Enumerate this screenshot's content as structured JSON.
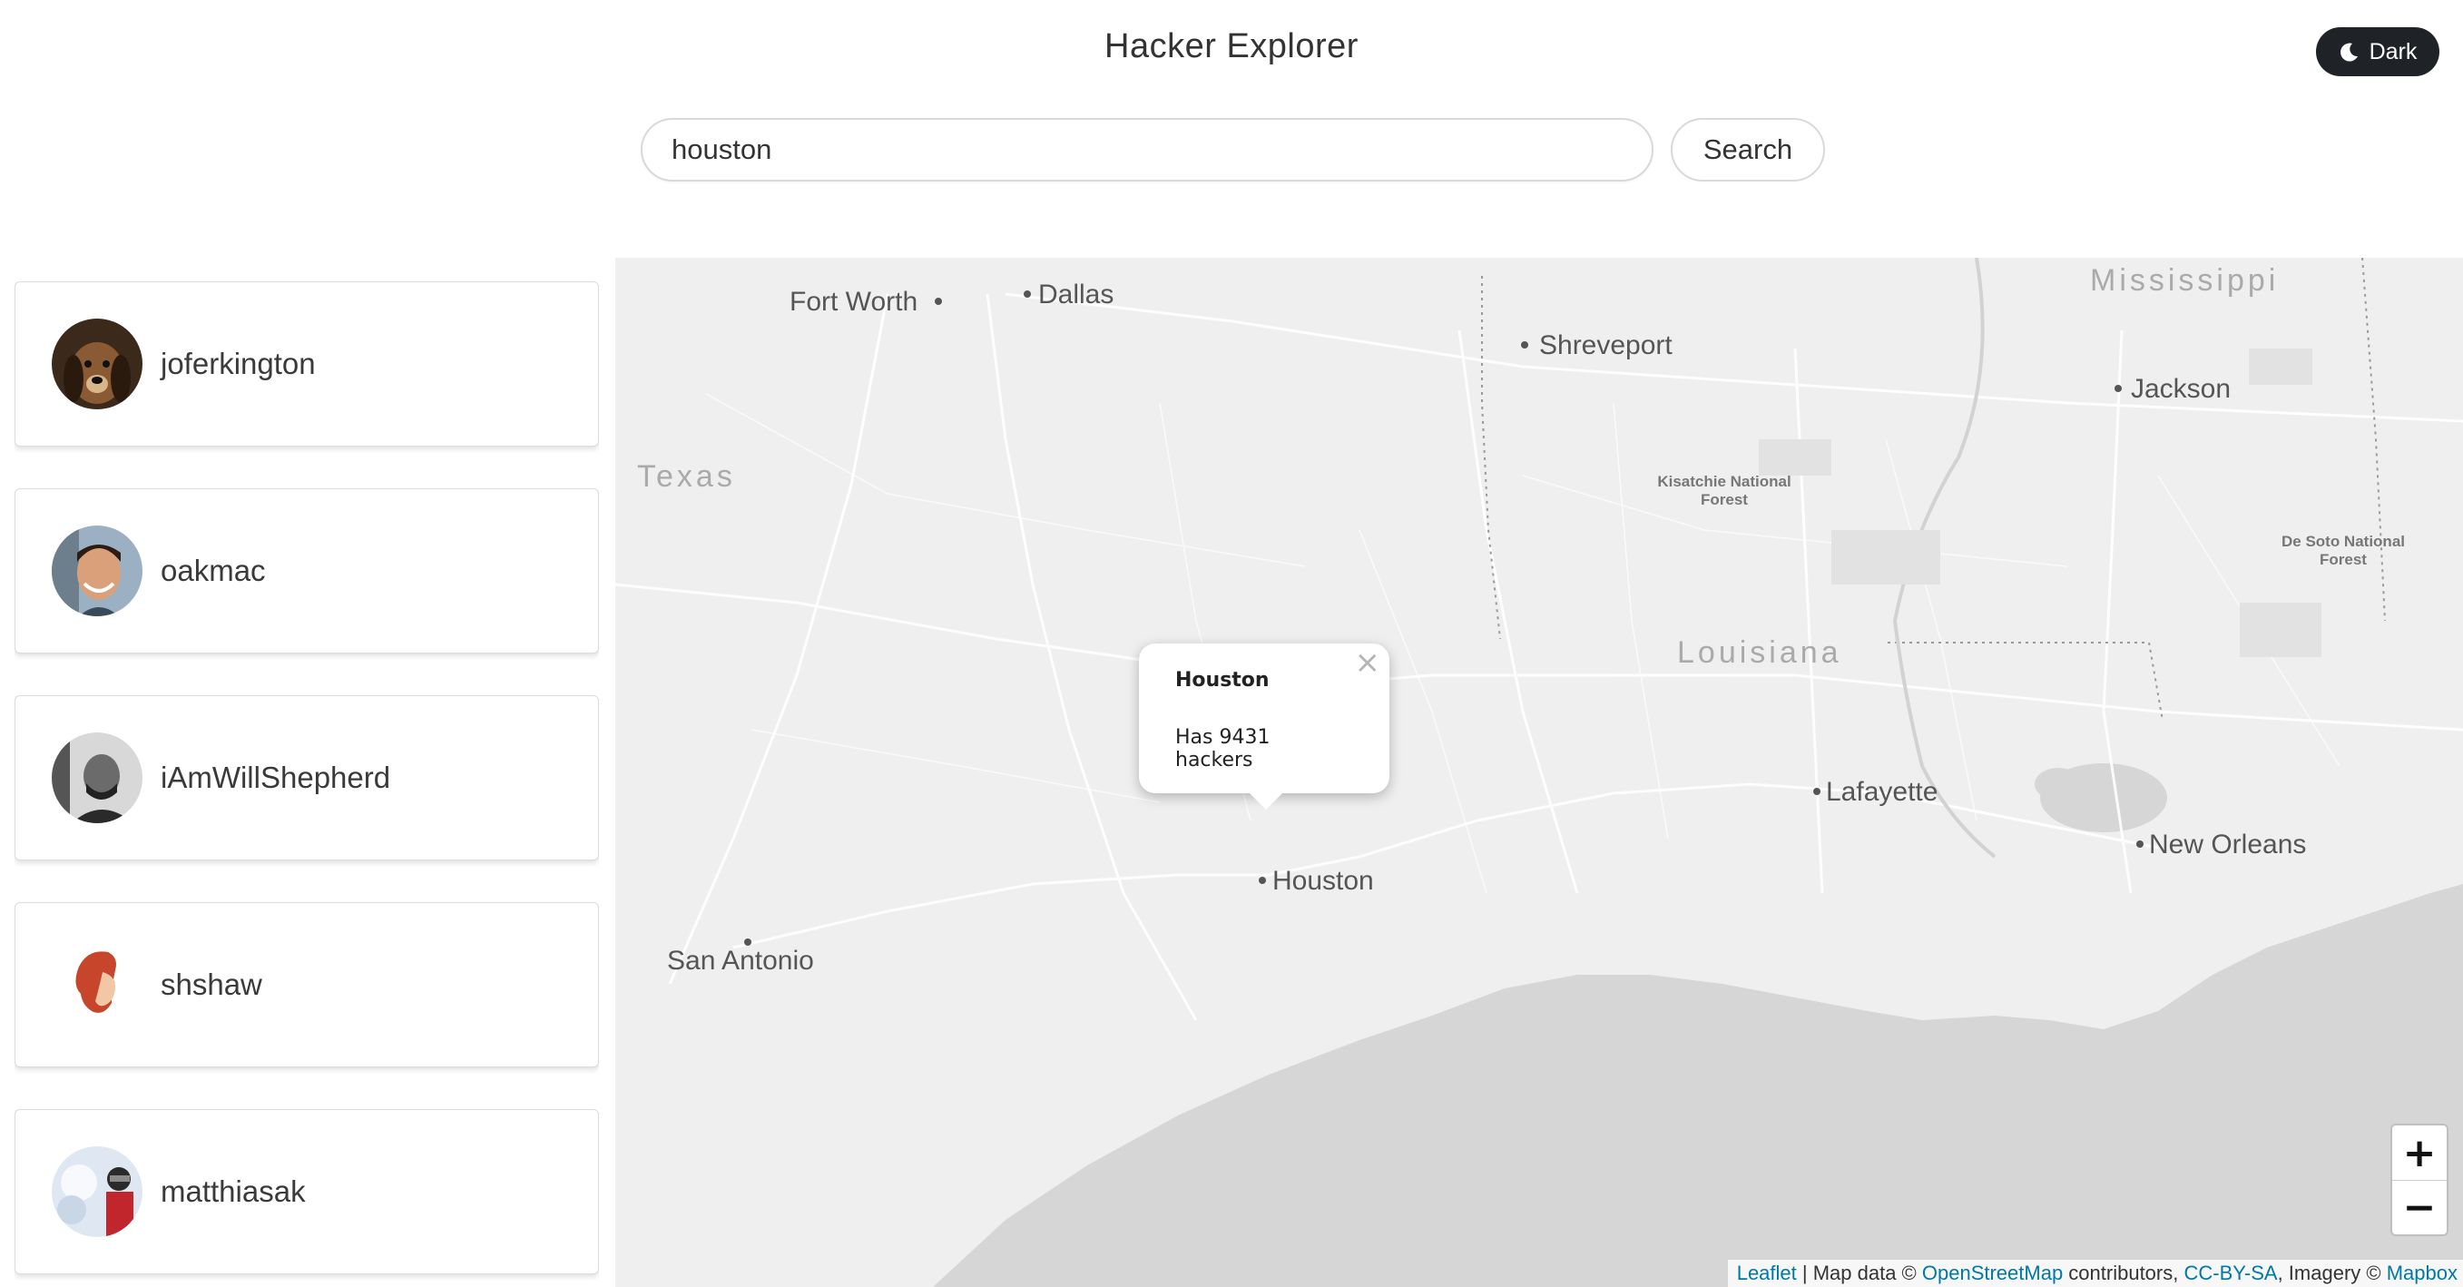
{
  "header": {
    "title": "Hacker Explorer",
    "theme_toggle_label": "Dark",
    "theme_toggle_icon": "moon-icon"
  },
  "search": {
    "value": "houston",
    "placeholder": "",
    "button_label": "Search"
  },
  "users": [
    {
      "name": "joferkington"
    },
    {
      "name": "oakmac"
    },
    {
      "name": "iAmWillShepherd"
    },
    {
      "name": "shshaw"
    },
    {
      "name": "matthiasak"
    }
  ],
  "map": {
    "labels": {
      "fort_worth": "Fort Worth",
      "dallas": "Dallas",
      "shreveport": "Shreveport",
      "jackson": "Jackson",
      "mississippi": "Mississippi",
      "texas": "Texas",
      "kisatchie": "Kisatchie National\nForest",
      "desoto": "De Soto National\nForest",
      "louisiana": "Louisiana",
      "lafayette": "Lafayette",
      "new_orleans": "New Orleans",
      "houston": "Houston",
      "san_antonio": "San Antonio"
    },
    "popup": {
      "title": "Houston",
      "body": "Has 9431 hackers",
      "close_symbol": "×"
    },
    "zoom": {
      "in_label": "+",
      "out_label": "−"
    },
    "attribution": {
      "leaflet": "Leaflet",
      "sep1": " | Map data © ",
      "osm": "OpenStreetMap",
      "contributors": " contributors, ",
      "license": "CC-BY-SA",
      "imagery": ", Imagery © ",
      "mapbox": "Mapbox"
    }
  },
  "colors": {
    "land": "#efefef",
    "water": "#d4d4d4",
    "roads": "#ffffff",
    "toggle_bg": "#1f2226",
    "link": "#0078a8"
  }
}
